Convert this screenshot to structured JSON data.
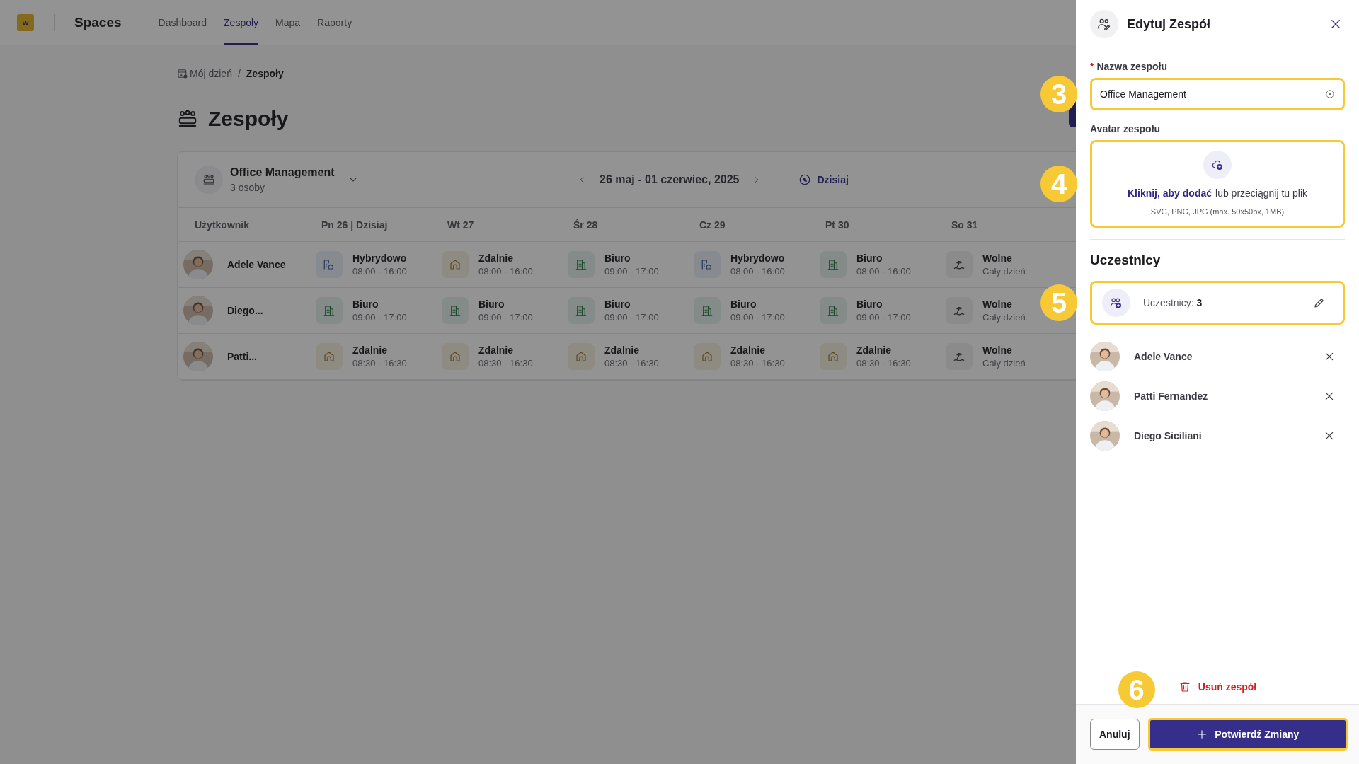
{
  "app": {
    "logo": "w",
    "name": "Spaces"
  },
  "nav": [
    {
      "label": "Dashboard",
      "selected": false
    },
    {
      "label": "Zespoły",
      "selected": true
    },
    {
      "label": "Mapa",
      "selected": false
    },
    {
      "label": "Raporty",
      "selected": false
    }
  ],
  "breadcrumb": {
    "items": [
      "Mój dzień",
      "Zespoły"
    ],
    "separator": "/"
  },
  "page_title": "Zespoły",
  "team_card": {
    "name": "Office Management",
    "count": "3 osoby",
    "date_range": "26 maj - 01 czerwiec, 2025",
    "today_button": "Dzisiaj"
  },
  "schedule": {
    "columns": [
      "Użytkownik",
      "Pn 26 | Dzisiaj",
      "Wt 27",
      "Śr 28",
      "Cz 29",
      "Pt 30",
      "So 31"
    ],
    "rows": [
      {
        "user": "Adele Vance",
        "days": [
          {
            "kind": "hybrid",
            "label": "Hybrydowo",
            "time": "08:00 - 16:00"
          },
          {
            "kind": "remote",
            "label": "Zdalnie",
            "time": "08:00 - 16:00"
          },
          {
            "kind": "office",
            "label": "Biuro",
            "time": "09:00 - 17:00"
          },
          {
            "kind": "hybrid",
            "label": "Hybrydowo",
            "time": "08:00 - 16:00"
          },
          {
            "kind": "office",
            "label": "Biuro",
            "time": "08:00 - 16:00"
          },
          {
            "kind": "off",
            "label": "Wolne",
            "time": "Cały dzień"
          }
        ]
      },
      {
        "user": "Diego...",
        "days": [
          {
            "kind": "office",
            "label": "Biuro",
            "time": "09:00 - 17:00"
          },
          {
            "kind": "office",
            "label": "Biuro",
            "time": "09:00 - 17:00"
          },
          {
            "kind": "office",
            "label": "Biuro",
            "time": "09:00 - 17:00"
          },
          {
            "kind": "office",
            "label": "Biuro",
            "time": "09:00 - 17:00"
          },
          {
            "kind": "office",
            "label": "Biuro",
            "time": "09:00 - 17:00"
          },
          {
            "kind": "off",
            "label": "Wolne",
            "time": "Cały dzień"
          }
        ]
      },
      {
        "user": "Patti...",
        "days": [
          {
            "kind": "remote",
            "label": "Zdalnie",
            "time": "08:30 - 16:30"
          },
          {
            "kind": "remote",
            "label": "Zdalnie",
            "time": "08:30 - 16:30"
          },
          {
            "kind": "remote",
            "label": "Zdalnie",
            "time": "08:30 - 16:30"
          },
          {
            "kind": "remote",
            "label": "Zdalnie",
            "time": "08:30 - 16:30"
          },
          {
            "kind": "remote",
            "label": "Zdalnie",
            "time": "08:30 - 16:30"
          },
          {
            "kind": "off",
            "label": "Wolne",
            "time": "Cały dzień"
          }
        ]
      }
    ]
  },
  "drawer": {
    "title": "Edytuj Zespół",
    "name_field": {
      "label": "Nazwa zespołu",
      "required_mark": "*",
      "value": "Office Management",
      "highlighted": true,
      "callout": "3"
    },
    "avatar_field": {
      "label": "Avatar zespołu",
      "action": "Kliknij, aby dodać",
      "action_rest": "lub przeciągnij tu plik",
      "hint": "SVG, PNG, JPG (max. 50x50px, 1MB)",
      "highlighted": true,
      "callout": "4"
    },
    "participants_heading": "Uczestnicy",
    "participants_summary": {
      "text": "Uczestnicy: **3**",
      "highlighted": true,
      "callout": "5"
    },
    "members": [
      {
        "name": "Adele Vance"
      },
      {
        "name": "Patti Fernandez"
      },
      {
        "name": "Diego Siciliani"
      }
    ],
    "delete_button": "Usuń zespół",
    "cancel_button": {
      "label": "Anuluj"
    },
    "confirm_button": {
      "label": "Potwierdź Zmiany",
      "highlighted": true,
      "callout": "6"
    }
  }
}
